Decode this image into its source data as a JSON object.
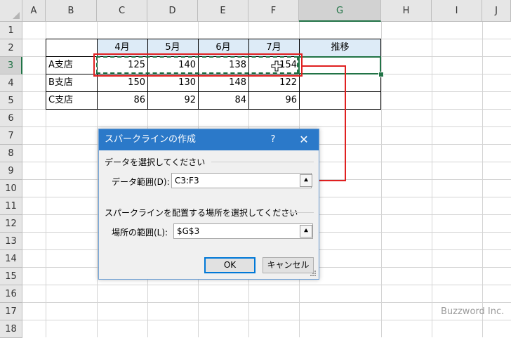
{
  "columns": [
    "A",
    "B",
    "C",
    "D",
    "E",
    "F",
    "G",
    "H",
    "I",
    "J"
  ],
  "rows": [
    "1",
    "2",
    "3",
    "4",
    "5",
    "6",
    "7",
    "8",
    "9",
    "10",
    "11",
    "12",
    "13",
    "14",
    "15",
    "16",
    "17",
    "18"
  ],
  "table": {
    "headers": [
      "4月",
      "5月",
      "6月",
      "7月",
      "推移"
    ],
    "rows": [
      {
        "label": "A支店",
        "values": [
          "125",
          "140",
          "138",
          "154"
        ]
      },
      {
        "label": "B支店",
        "values": [
          "150",
          "130",
          "148",
          "122"
        ]
      },
      {
        "label": "C支店",
        "values": [
          "86",
          "92",
          "84",
          "96"
        ]
      }
    ]
  },
  "dialog": {
    "title": "スパークラインの作成",
    "help": "?",
    "close": "✕",
    "data_group": "データを選択してください",
    "data_range_label": "データ範囲(D):",
    "data_range_value": "C3:F3",
    "location_group": "スパークラインを配置する場所を選択してください",
    "location_label": "場所の範囲(L):",
    "location_value": "$G$3",
    "collapse_icon": "⯅",
    "ok": "OK",
    "cancel": "キャンセル"
  },
  "watermark": "Buzzword Inc.",
  "colors": {
    "accent": "#217346",
    "highlight": "#e02020",
    "dialog_title": "#2b79c9",
    "header_fill": "#ddebf7"
  }
}
